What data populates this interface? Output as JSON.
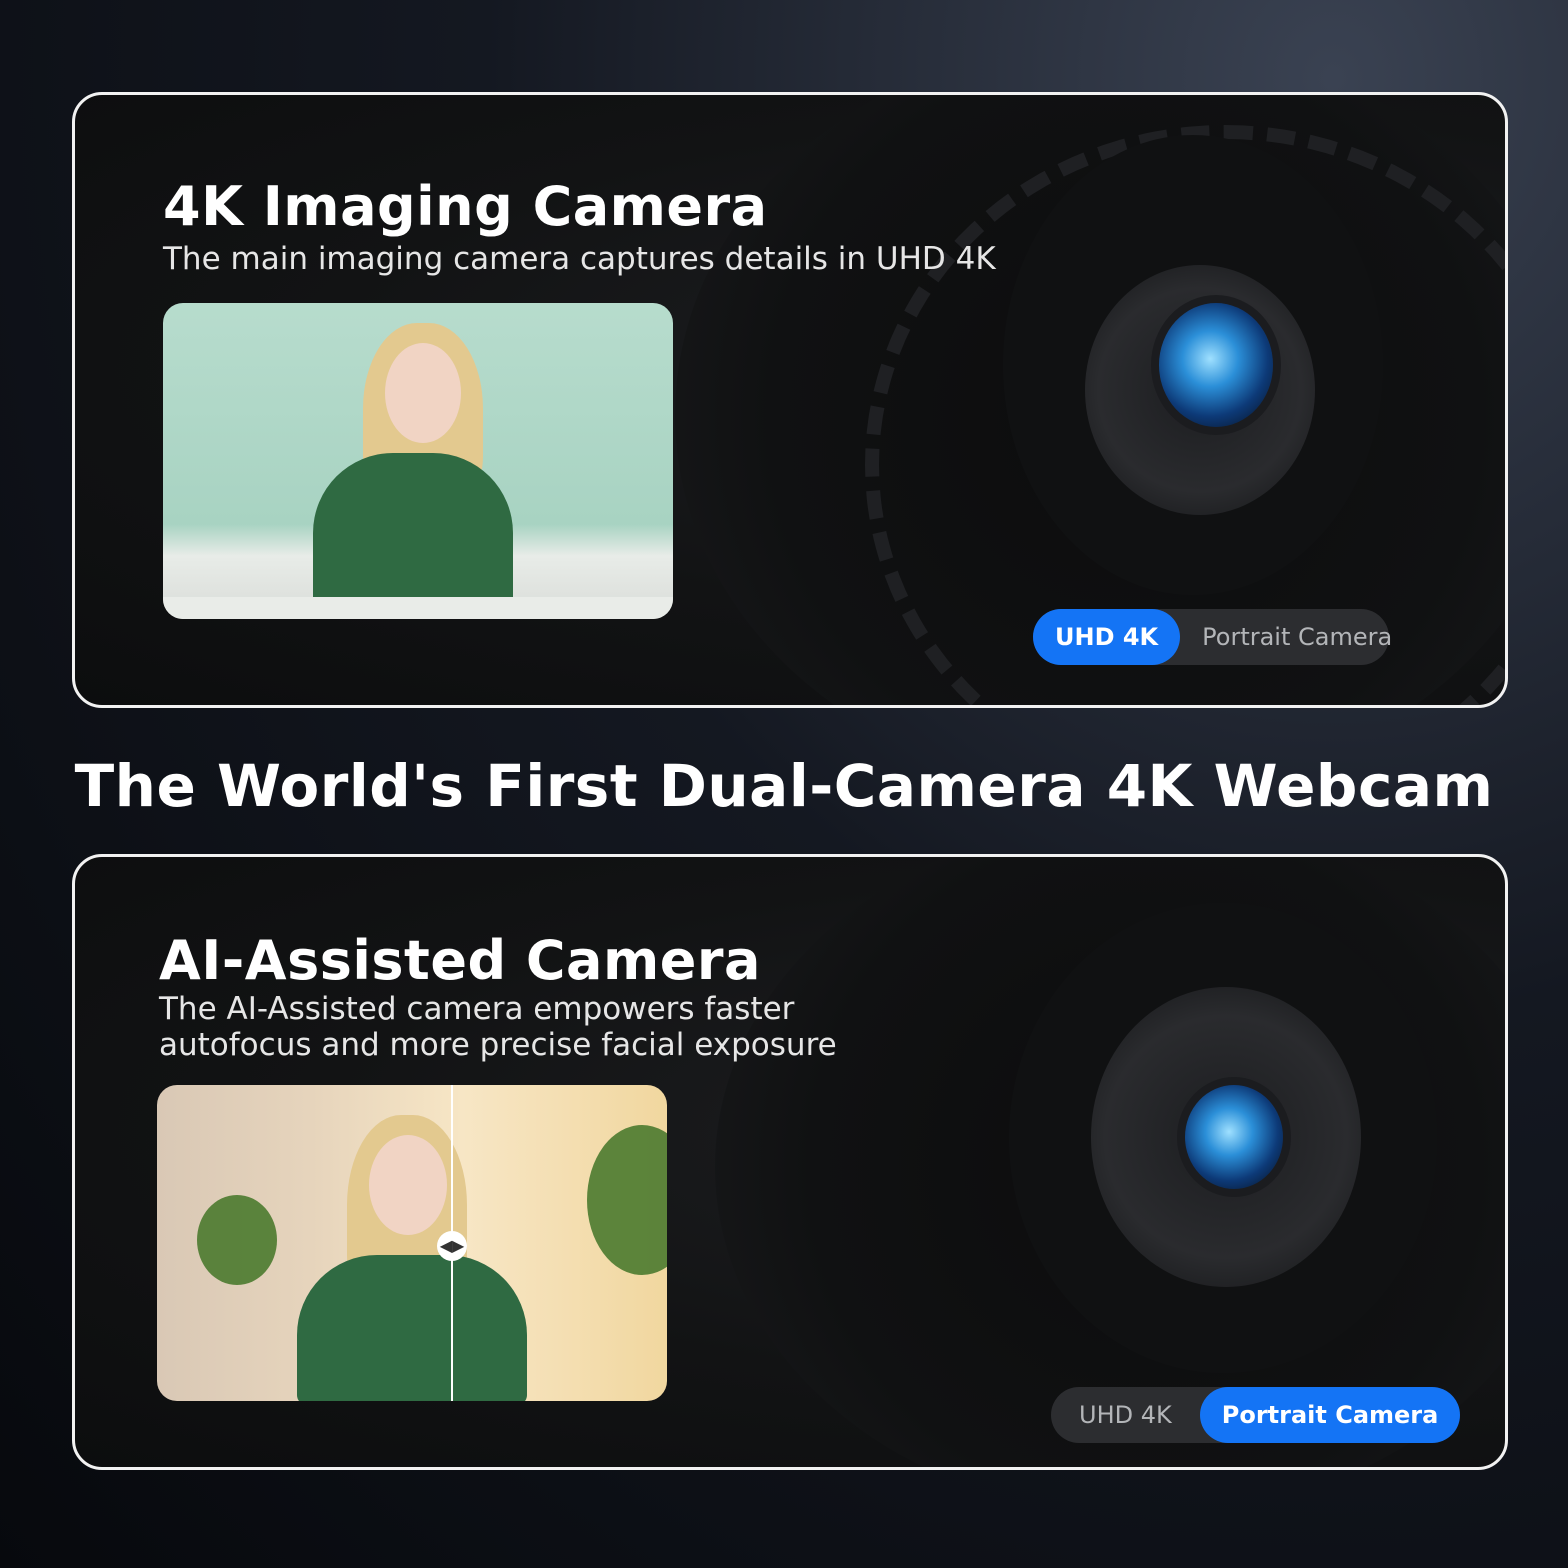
{
  "headline": "The World's First Dual-Camera 4K Webcam",
  "cards": [
    {
      "title": "4K Imaging Camera",
      "description": "The main imaging camera captures details in UHD 4K",
      "toggle": {
        "options": [
          "UHD 4K",
          "Portrait Camera"
        ],
        "active": "UHD 4K"
      }
    },
    {
      "title": "AI-Assisted Camera",
      "description": "The AI-Assisted camera empowers faster autofocus and more precise facial exposure",
      "toggle": {
        "options": [
          "UHD 4K",
          "Portrait Camera"
        ],
        "active": "Portrait Camera"
      }
    }
  ],
  "colors": {
    "accent": "#1474f5",
    "border": "#f2f2f2",
    "background": "#0c0d0e"
  },
  "icons": [
    "camera-lens-icon",
    "compare-slider-icon"
  ]
}
